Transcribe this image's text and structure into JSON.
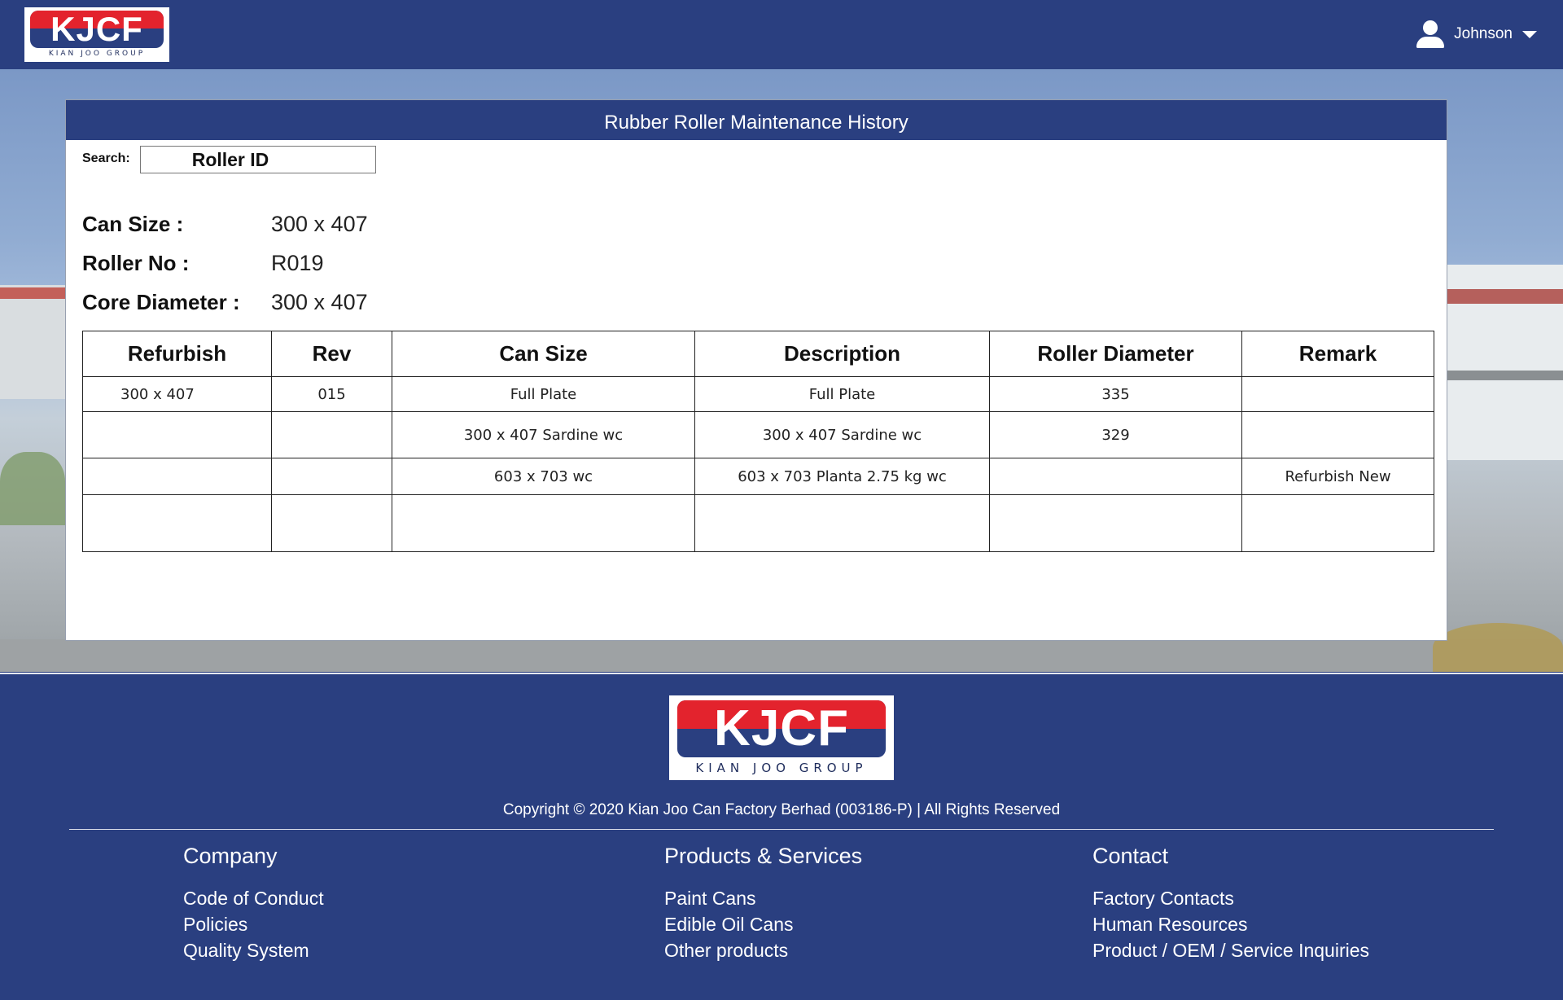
{
  "header": {
    "logo_text": "KJCF",
    "logo_subtitle": "KIAN JOO GROUP",
    "user_name": "Johnson"
  },
  "panel": {
    "title": "Rubber Roller Maintenance History",
    "search_label": "Search:",
    "search_value": "Roller ID",
    "info": [
      {
        "label": "Can Size :",
        "value": "300 x 407"
      },
      {
        "label": "Roller No :",
        "value": "R019"
      },
      {
        "label": "Core Diameter :",
        "value": "300 x 407"
      }
    ],
    "table": {
      "headers": [
        "Refurbish",
        "Rev",
        "Can Size",
        "Description",
        "Roller Diameter",
        "Remark"
      ],
      "rows": [
        [
          "300 x 407",
          "015",
          "Full Plate",
          "Full Plate",
          "335",
          ""
        ],
        [
          "",
          "",
          "300 x 407 Sardine wc",
          "300 x 407 Sardine wc",
          "329",
          ""
        ],
        [
          "",
          "",
          "603 x 703 wc",
          "603 x 703 Planta 2.75 kg wc",
          "",
          "Refurbish New"
        ],
        [
          "",
          "",
          "",
          "",
          "",
          ""
        ]
      ]
    }
  },
  "footer": {
    "logo_text": "KJCF",
    "logo_subtitle": "KIAN JOO GROUP",
    "copyright": "Copyright © 2020 Kian Joo Can Factory Berhad (003186-P) | All Rights Reserved",
    "columns": [
      {
        "title": "Company",
        "links": [
          "Code of Conduct",
          "Policies",
          "Quality System"
        ]
      },
      {
        "title": "Products & Services",
        "links": [
          "Paint Cans",
          "Edible Oil Cans",
          "Other products"
        ]
      },
      {
        "title": "Contact",
        "links": [
          "Factory Contacts",
          "Human Resources",
          "Product / OEM / Service Inquiries"
        ]
      }
    ]
  }
}
